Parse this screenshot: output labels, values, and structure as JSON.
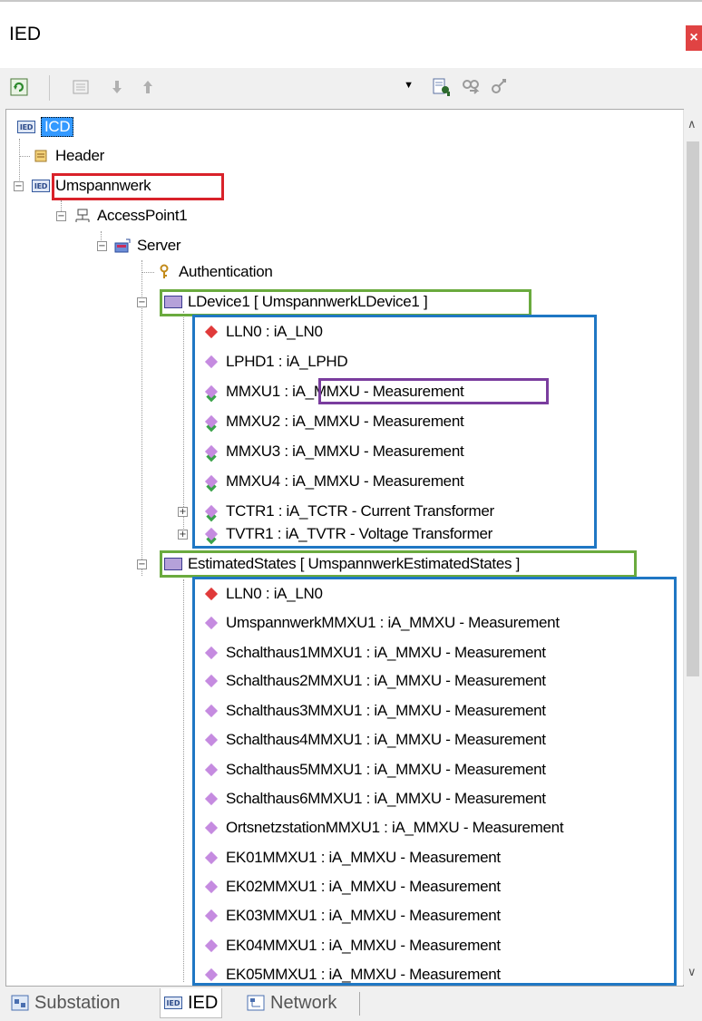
{
  "window": {
    "title": "IED",
    "close_glyph": "×"
  },
  "toolbar": {
    "refresh_icon": "refresh-icon",
    "view_icon": "view-icon",
    "down_icon": "arrow-down-icon",
    "up_icon": "arrow-up-icon",
    "dropdown_value": "",
    "find_icon": "find-icon",
    "find_next_icon": "find-next-icon",
    "replace_icon": "replace-icon"
  },
  "tree": {
    "root": "ICD",
    "header": "Header",
    "ied": "Umspannwerk",
    "access_point": "AccessPoint1",
    "server": "Server",
    "authentication": "Authentication",
    "ldevice1": {
      "label": "LDevice1 [ UmspannwerkLDevice1 ]",
      "nodes": [
        "LLN0 : iA_LN0",
        "LPHD1 : iA_LPHD",
        "MMXU1 : iA_MMXU - Measurement",
        "MMXU2 : iA_MMXU - Measurement",
        "MMXU3 : iA_MMXU - Measurement",
        "MMXU4 : iA_MMXU - Measurement",
        "TCTR1 : iA_TCTR - Current Transformer",
        "TVTR1 : iA_TVTR - Voltage Transformer"
      ]
    },
    "estimated_states": {
      "label": "EstimatedStates [ UmspannwerkEstimatedStates ]",
      "nodes": [
        "LLN0 : iA_LN0",
        "UmspannwerkMMXU1 : iA_MMXU - Measurement",
        "Schalthaus1MMXU1 : iA_MMXU - Measurement",
        "Schalthaus2MMXU1 : iA_MMXU - Measurement",
        "Schalthaus3MMXU1 : iA_MMXU - Measurement",
        "Schalthaus4MMXU1 : iA_MMXU - Measurement",
        "Schalthaus5MMXU1 : iA_MMXU - Measurement",
        "Schalthaus6MMXU1 : iA_MMXU - Measurement",
        "OrtsnetzstationMMXU1 : iA_MMXU - Measurement",
        "EK01MMXU1 : iA_MMXU - Measurement",
        "EK02MMXU1 : iA_MMXU - Measurement",
        "EK03MMXU1 : iA_MMXU - Measurement",
        "EK04MMXU1 : iA_MMXU - Measurement",
        "EK05MMXU1 : iA_MMXU - Measurement"
      ]
    }
  },
  "tabs": [
    {
      "label": "Substation",
      "active": false
    },
    {
      "label": "IED",
      "active": true
    },
    {
      "label": "Network",
      "active": false
    }
  ],
  "colors": {
    "highlight_red": "#d9222a",
    "highlight_green": "#6aaa3e",
    "highlight_blue": "#1f77c4",
    "highlight_purple": "#7a3d9e",
    "lln0_diamond": "#e03a3a",
    "ln_diamond": "#c58be0",
    "selection": "#3399ff"
  }
}
